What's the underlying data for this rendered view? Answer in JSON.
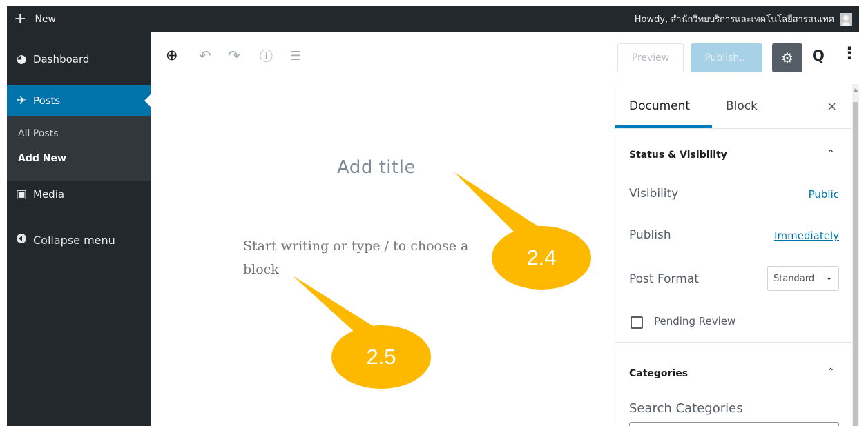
{
  "adminbar": {
    "new_label": "New",
    "howdy": "Howdy, สำนักวิทยบริการและเทคโนโลยีสารสนเทศ"
  },
  "menu": {
    "dashboard": "Dashboard",
    "posts": "Posts",
    "sub_all_posts": "All Posts",
    "sub_add_new": "Add New",
    "media": "Media",
    "collapse": "Collapse menu"
  },
  "toolbar": {
    "preview_label": "Preview",
    "publish_label": "Publish...",
    "add_glyph": "⊕",
    "undo_glyph": "↶",
    "redo_glyph": "↷",
    "info_glyph": "ⓘ",
    "outline_glyph": "☰",
    "settings_glyph": "⚙",
    "plugin_glyph": "Q",
    "more_glyph": "⋮"
  },
  "editor": {
    "title_placeholder": "Add title",
    "body_placeholder": "Start writing or type / to choose a block"
  },
  "callouts": {
    "first": "2.4",
    "second": "2.5",
    "color": "#fcb900"
  },
  "sidebar": {
    "tab_document": "Document",
    "tab_block": "Block",
    "close_glyph": "×",
    "status_title": "Status & Visibility",
    "visibility_label": "Visibility",
    "visibility_value": "Public",
    "publish_label": "Publish",
    "publish_value": "Immediately",
    "format_label": "Post Format",
    "format_value": "Standard",
    "pending_label": "Pending Review",
    "categories_title": "Categories",
    "search_categories_label": "Search Categories"
  },
  "colors": {
    "admin_dark": "#23282d",
    "active_blue": "#0073aa",
    "link_blue": "#0073aa"
  }
}
